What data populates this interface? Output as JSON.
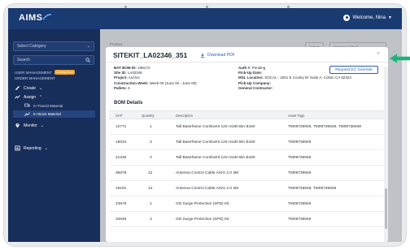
{
  "app": {
    "logo": "AIMS",
    "welcome": "Welcome, Nina"
  },
  "sidebar": {
    "select_category": "Select Category",
    "search_placeholder": "Search",
    "user_management": "USER MANAGEMENT",
    "user_management_badge": "Coming Soon",
    "order_management": "ORDER MANAGEMENT",
    "create": "Create",
    "assign": "Assign",
    "in_transit": "In-Transit Material",
    "in_stock": "In-Stock Material",
    "monitor": "Monitor",
    "reporting": "Reporting"
  },
  "background": {
    "field_label": "Product",
    "btn_a": "Actions",
    "btn_b": "Search by Site ID"
  },
  "modal": {
    "title": "SITEKIT_LA02346_351",
    "download": "Download PDF",
    "close": "×",
    "left_info": [
      {
        "label": "BAT BOM ID:",
        "value": "438174"
      },
      {
        "label": "Site ID:",
        "value": "LA02346"
      },
      {
        "label": "Project:",
        "value": "Anchor"
      },
      {
        "label": "Construction Week:",
        "value": "Week 00 (June 00 - June 00)"
      },
      {
        "label": "Pallets:",
        "value": "6"
      }
    ],
    "right_info": [
      {
        "label": "Auth #:",
        "value": "Pending"
      },
      {
        "label": "Pick-Up Date:",
        "value": ""
      },
      {
        "label": "MSL Location:",
        "value": "SOCAL - 1501 E Cooley Dr Suite A, Colton CA 92324"
      },
      {
        "label": "Pick-Up Company:",
        "value": ""
      },
      {
        "label": "General Contractor:",
        "value": ""
      }
    ],
    "request_button": "Request EC Override",
    "bom_title": "BOM Details",
    "columns": {
      "sap": "SAP",
      "quantity": "Quantity",
      "description": "Description",
      "asset_tags": "Asset Tags"
    },
    "rows": [
      {
        "sap": "12771",
        "quantity": "1",
        "description": "Tall Baseframe ComboKit 12m 6160 Bin B160",
        "tags": "TM09736948, TM09736948, TM09736948"
      },
      {
        "sap": "15024",
        "quantity": "3",
        "description": "Tall Baseframe ComboKit 12m 6160 Bin B160",
        "tags": "TM09736948"
      },
      {
        "sap": "21245",
        "quantity": "3",
        "description": "Tall Baseframe ComboKit 12m 6160 Bin B160",
        "tags": "TM09736948"
      },
      {
        "sap": "36678",
        "quantity": "12",
        "description": "Antenna Control Cable AISG 2.0 3M",
        "tags": "TM09736948"
      },
      {
        "sap": "19191",
        "quantity": "12",
        "description": "Antenna Control Cable AISG 2.0 3M",
        "tags": "TM09736948, TM09736948"
      },
      {
        "sap": "23576",
        "quantity": "1",
        "description": "GD Surge Protection (SPD) Kit",
        "tags": "TM09736948"
      },
      {
        "sap": "34645",
        "quantity": "3",
        "description": "GD Surge Protection (SPD) Kit",
        "tags": "TM09736948"
      }
    ]
  },
  "colors": {
    "topbar": "#1a3a72",
    "sidebar": "#172d5a",
    "accent": "#2a5db0",
    "badge": "#f0a22c",
    "pointer_arrow": "#1db37a"
  }
}
